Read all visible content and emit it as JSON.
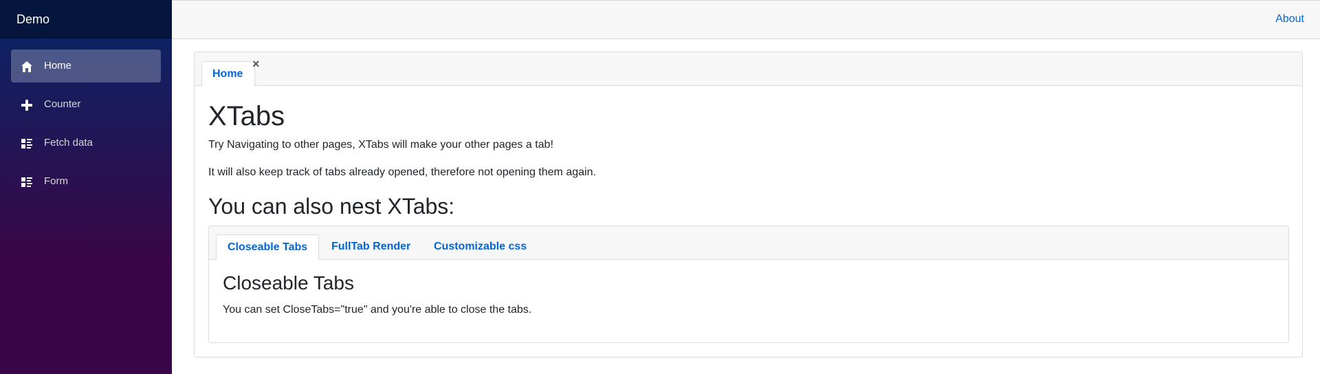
{
  "sidebar": {
    "brand": "Demo",
    "items": [
      {
        "label": "Home",
        "icon": "home-icon",
        "active": true
      },
      {
        "label": "Counter",
        "icon": "plus-icon",
        "active": false
      },
      {
        "label": "Fetch data",
        "icon": "list-icon",
        "active": false
      },
      {
        "label": "Form",
        "icon": "list-icon",
        "active": false
      }
    ]
  },
  "topbar": {
    "about_label": "About"
  },
  "outer_tabs": {
    "tabs": [
      {
        "label": "Home",
        "close_symbol": "×",
        "active": true
      }
    ]
  },
  "home": {
    "heading": "XTabs",
    "paragraph1": "Try Navigating to other pages, XTabs will make your other pages a tab!",
    "paragraph2": "It will also keep track of tabs already opened, therefore not opening them again.",
    "subheading": "You can also nest XTabs:"
  },
  "inner_tabs": {
    "tabs": [
      {
        "label": "Closeable Tabs",
        "active": true
      },
      {
        "label": "FullTab Render",
        "active": false
      },
      {
        "label": "Customizable css",
        "active": false
      }
    ],
    "content_title": "Closeable Tabs",
    "content_text": "You can set CloseTabs=\"true\" and you're able to close the tabs."
  },
  "colors": {
    "link": "#0366d6",
    "sidebar_top": "#052767",
    "sidebar_bottom": "#3a0647",
    "topbar_bg": "#f7f7f7"
  }
}
